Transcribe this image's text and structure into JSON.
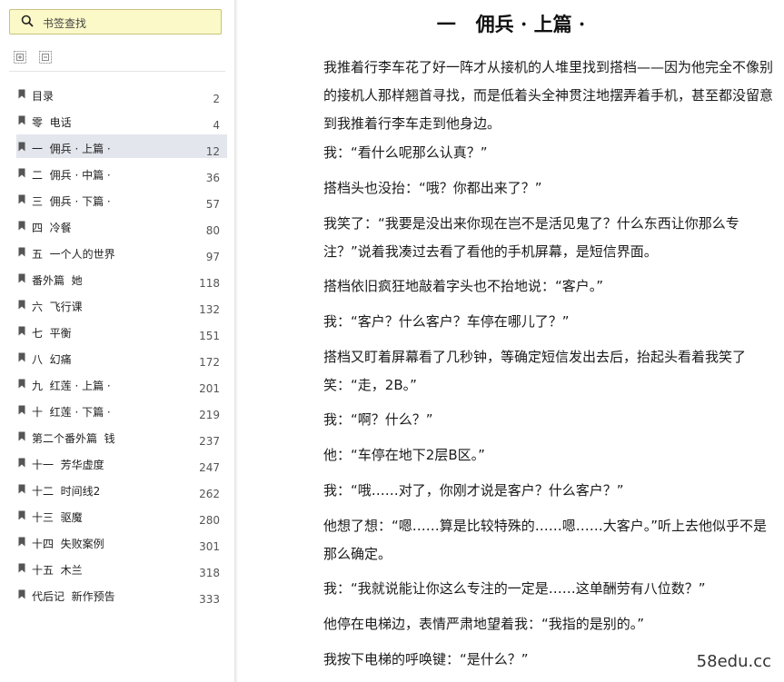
{
  "search": {
    "placeholder": "书签查找"
  },
  "toc": {
    "items": [
      {
        "label": "目录",
        "page": "2"
      },
      {
        "label": "零  电话",
        "page": "4"
      },
      {
        "label": "一  佣兵 · 上篇 ·",
        "page": "12",
        "active": true
      },
      {
        "label": "二  佣兵 · 中篇 ·",
        "page": "36"
      },
      {
        "label": "三  佣兵 · 下篇 ·",
        "page": "57"
      },
      {
        "label": "四  冷餐",
        "page": "80"
      },
      {
        "label": "五  一个人的世界",
        "page": "97"
      },
      {
        "label": "番外篇  她",
        "page": "118"
      },
      {
        "label": "六  飞行课",
        "page": "132"
      },
      {
        "label": "七  平衡",
        "page": "151"
      },
      {
        "label": "八  幻痛",
        "page": "172"
      },
      {
        "label": "九  红莲 · 上篇 ·",
        "page": "201"
      },
      {
        "label": "十  红莲 · 下篇 ·",
        "page": "219"
      },
      {
        "label": "第二个番外篇  钱",
        "page": "237"
      },
      {
        "label": "十一  芳华虚度",
        "page": "247"
      },
      {
        "label": "十二  时间线2",
        "page": "262"
      },
      {
        "label": "十三  驱魔",
        "page": "280"
      },
      {
        "label": "十四  失败案例",
        "page": "301"
      },
      {
        "label": "十五  木兰",
        "page": "318"
      },
      {
        "label": "代后记  新作预告",
        "page": "333"
      }
    ]
  },
  "document": {
    "title": "一   佣兵 · 上篇 ·",
    "paragraphs": [
      "我推着行李车花了好一阵才从接机的人堆里找到搭档——因为他完全不像别的接机人那样翘首寻找，而是低着头全神贯注地摆弄着手机，甚至都没留意到我推着行李车走到他身边。",
      "我：“看什么呢那么认真？”",
      "搭档头也没抬：“哦？你都出来了？”",
      "我笑了：“我要是没出来你现在岂不是活见鬼了？什么东西让你那么专注？”说着我凑过去看了看他的手机屏幕，是短信界面。",
      "搭档依旧疯狂地敲着字头也不抬地说：“客户。”",
      "我：“客户？什么客户？车停在哪儿了？”",
      "搭档又盯着屏幕看了几秒钟，等确定短信发出去后，抬起头看着我笑了笑：“走，2B。”",
      "我：“啊？什么？”",
      "他：“车停在地下2层B区。”",
      "我：“哦……对了，你刚才说是客户？什么客户？”",
      "他想了想：“嗯……算是比较特殊的……嗯……大客户。”听上去他似乎不是那么确定。",
      "我：“我就说能让你这么专注的一定是……这单酬劳有八位数？”",
      "他停在电梯边，表情严肃地望着我：“我指的是别的。”",
      "我按下电梯的呼唤键：“是什么？”"
    ]
  },
  "watermark": "58edu.cc"
}
